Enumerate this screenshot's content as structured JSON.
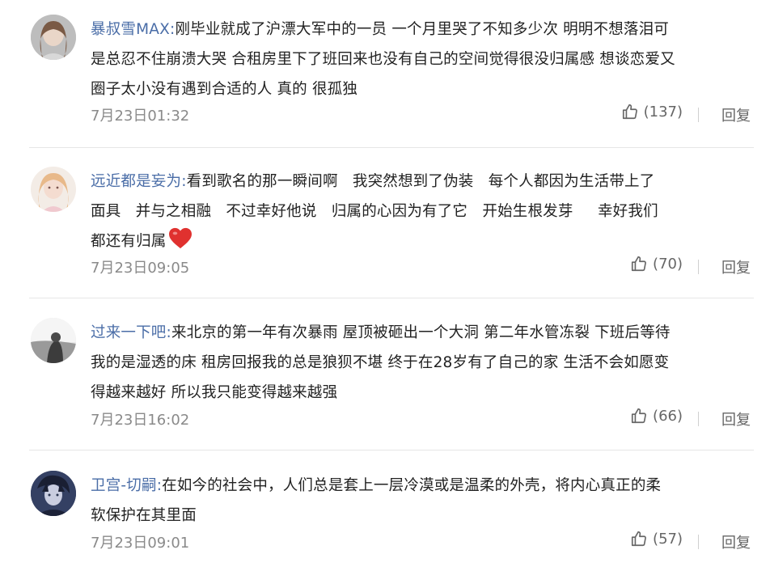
{
  "comments": [
    {
      "username": "暴叔雪MAX",
      "colon": ":",
      "lines": [
        "刚毕业就成了沪漂大军中的一员 一个月里哭了不知多少次 明明不想落泪可",
        "是总忍不住崩溃大哭 合租房里下了班回来也没有自己的空间觉得很没归属感 想谈恋爱又",
        "圈子太小没有遇到合适的人 真的 很孤独"
      ],
      "time": "7月23日01:32",
      "likes": "(137)",
      "reply": "回复",
      "avatar": "avatar-woman-gray"
    },
    {
      "username": "远近都是妄为",
      "colon": ":",
      "lines": [
        "看到歌名的那一瞬间啊   我突然想到了伪装   每个人都因为生活带上了",
        "面具   并与之相融   不过幸好他说   归属的心因为有了它   开始生根发芽     幸好我们",
        "都还有归属"
      ],
      "emoji": "red-heart-icon",
      "time": "7月23日09:05",
      "likes": "(70)",
      "reply": "回复",
      "avatar": "avatar-girl-pink"
    },
    {
      "username": "过来一下吧",
      "colon": ":",
      "lines": [
        "来北京的第一年有次暴雨 屋顶被砸出一个大洞 第二年水管冻裂 下班后等待",
        "我的是湿透的床 租房回报我的总是狼狈不堪 终于在28岁有了自己的家 生活不会如愿变",
        "得越来越好 所以我只能变得越来越强"
      ],
      "time": "7月23日16:02",
      "likes": "(66)",
      "reply": "回复",
      "avatar": "avatar-person-gray"
    },
    {
      "username": "卫宫-切嗣",
      "colon": ":",
      "lines": [
        "在如今的社会中，人们总是套上一层冷漠或是温柔的外壳，将内心真正的柔",
        "软保护在其里面"
      ],
      "time": "7月23日09:01",
      "likes": "(57)",
      "reply": "回复",
      "avatar": "avatar-anime-dark"
    }
  ],
  "colors": {
    "username": "#4a6da7",
    "text": "#222222",
    "meta": "#8a8a8a",
    "heart": "#e0312f"
  },
  "icons": {
    "like": "thumbs-up-icon"
  }
}
